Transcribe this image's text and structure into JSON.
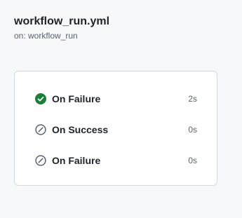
{
  "workflow": {
    "title": "workflow_run.yml",
    "trigger": "on: workflow_run"
  },
  "jobs": [
    {
      "name": "On Failure",
      "duration": "2s",
      "status": "success",
      "icon": "check-circle-fill-icon",
      "color": "#1a7f37"
    },
    {
      "name": "On Success",
      "duration": "0s",
      "status": "skipped",
      "icon": "skip-icon",
      "color": "#59636e"
    },
    {
      "name": "On Failure",
      "duration": "0s",
      "status": "skipped",
      "icon": "skip-icon",
      "color": "#59636e"
    }
  ]
}
